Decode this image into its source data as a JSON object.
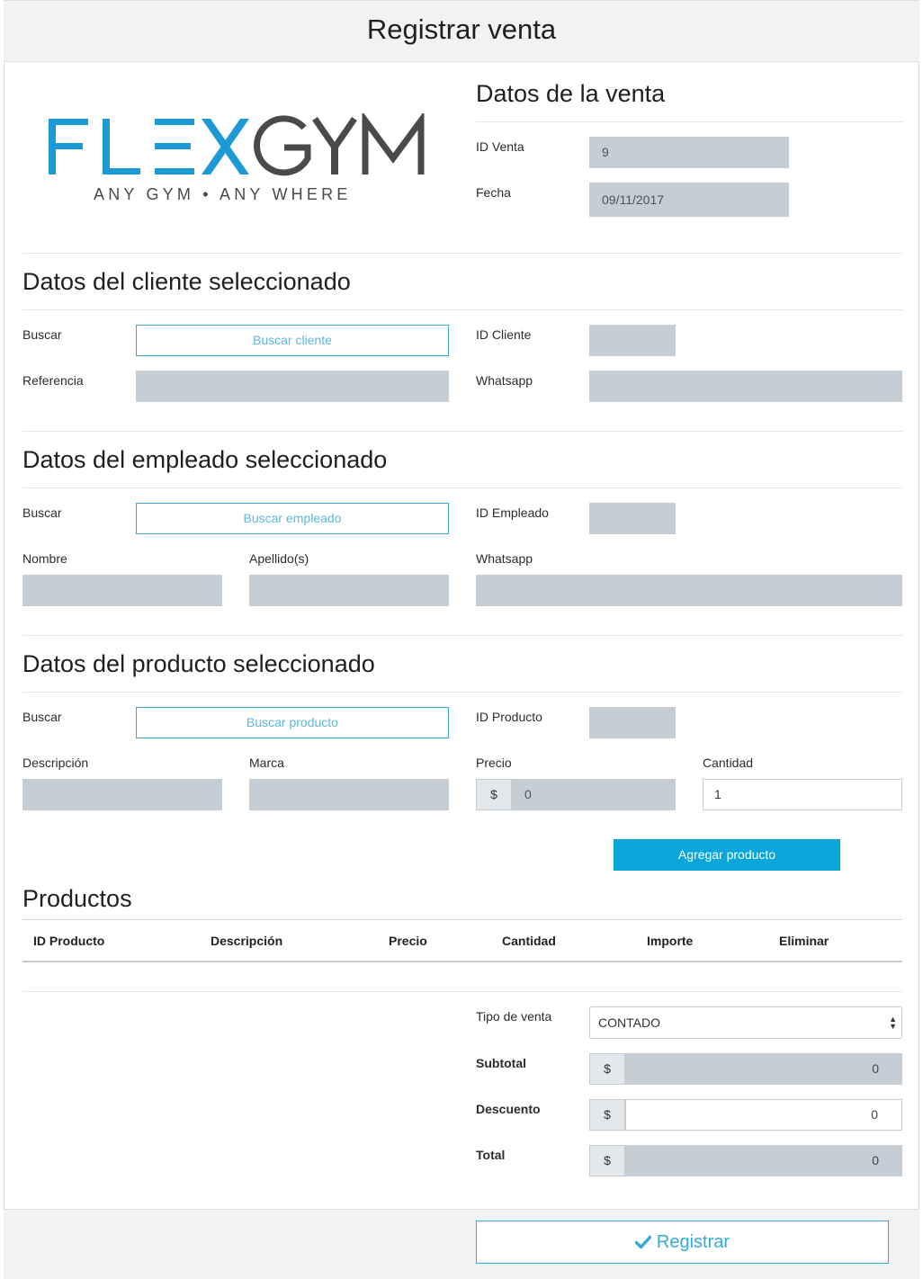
{
  "header": {
    "title": "Registrar venta"
  },
  "logo": {
    "brand_part1": "FL",
    "brand_part2": "E",
    "brand_part3": "X",
    "brand_part4": "GYM",
    "tagline": "ANY GYM • ANY WHERE",
    "accent": "#1b9ad6",
    "dark": "#4a4a4a"
  },
  "venta": {
    "title": "Datos de la venta",
    "id_label": "ID Venta",
    "id_value": "9",
    "fecha_label": "Fecha",
    "fecha_value": "09/11/2017"
  },
  "cliente": {
    "title": "Datos del cliente seleccionado",
    "buscar_label": "Buscar",
    "buscar_button": "Buscar cliente",
    "id_label": "ID Cliente",
    "referencia_label": "Referencia",
    "whatsapp_label": "Whatsapp"
  },
  "empleado": {
    "title": "Datos del empleado seleccionado",
    "buscar_label": "Buscar",
    "buscar_button": "Buscar empleado",
    "id_label": "ID Empleado",
    "nombre_label": "Nombre",
    "apellido_label": "Apellido(s)",
    "whatsapp_label": "Whatsapp"
  },
  "producto": {
    "title": "Datos del producto seleccionado",
    "buscar_label": "Buscar",
    "buscar_button": "Buscar producto",
    "id_label": "ID Producto",
    "descripcion_label": "Descripción",
    "marca_label": "Marca",
    "precio_label": "Precio",
    "precio_currency": "$",
    "precio_value": "0",
    "cantidad_label": "Cantidad",
    "cantidad_value": "1",
    "agregar_button": "Agregar producto"
  },
  "productos": {
    "title": "Productos",
    "columns": [
      "ID Producto",
      "Descripción",
      "Precio",
      "Cantidad",
      "Importe",
      "Eliminar"
    ]
  },
  "totales": {
    "tipo_label": "Tipo de venta",
    "tipo_value": "CONTADO",
    "subtotal_label": "Subtotal",
    "subtotal_value": "0",
    "descuento_label": "Descuento",
    "descuento_value": "0",
    "total_label": "Total",
    "total_value": "0",
    "currency": "$"
  },
  "footer": {
    "register_button": "Registrar"
  }
}
